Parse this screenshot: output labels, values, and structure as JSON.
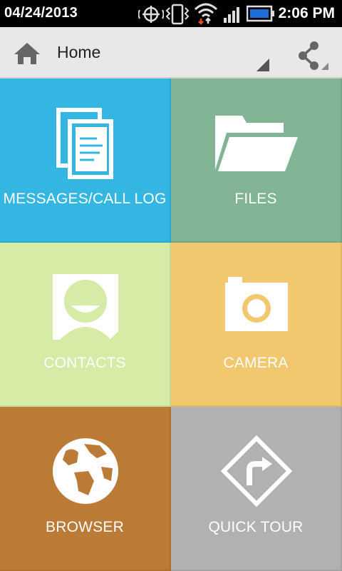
{
  "status_bar": {
    "date": "04/24/2013",
    "time": "2:06 PM",
    "icons": [
      "gps-icon",
      "vibrate-icon",
      "wifi-icon",
      "signal-icon",
      "battery-icon"
    ]
  },
  "action_bar": {
    "title": "Home",
    "home_icon": "home-icon",
    "share_icon": "share-icon"
  },
  "tiles": [
    {
      "label": "MESSAGES/CALL LOG",
      "icon": "documents-icon",
      "color": "#33b7e2"
    },
    {
      "label": "FILES",
      "icon": "folder-icon",
      "color": "#80b494"
    },
    {
      "label": "CONTACTS",
      "icon": "contact-icon",
      "color": "#d6eba6"
    },
    {
      "label": "CAMERA",
      "icon": "camera-icon",
      "color": "#f1c86e"
    },
    {
      "label": "BROWSER",
      "icon": "globe-icon",
      "color": "#bb7b36"
    },
    {
      "label": "QUICK TOUR",
      "icon": "turn-sign-icon",
      "color": "#b1b1b1"
    }
  ]
}
